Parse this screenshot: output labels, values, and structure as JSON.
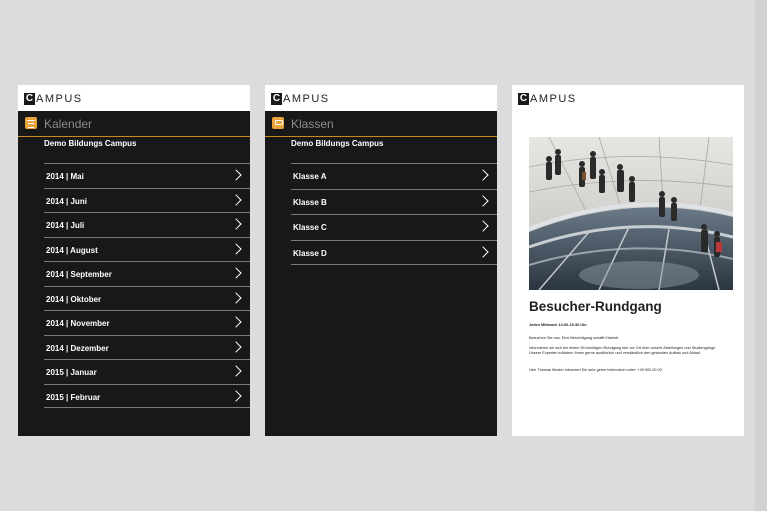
{
  "logo": {
    "initial": "C",
    "rest": "AMPUS"
  },
  "calendar": {
    "header": "Kalender",
    "icon": "calendar-icon",
    "subtitle": "Demo Bildungs Campus",
    "items": [
      {
        "label": "2014 | Mai"
      },
      {
        "label": "2014 | Juni"
      },
      {
        "label": "2014 | Juli"
      },
      {
        "label": "2014 | August"
      },
      {
        "label": "2014 | September"
      },
      {
        "label": "2014 | Oktober"
      },
      {
        "label": "2014 | November"
      },
      {
        "label": "2014 | Dezember"
      },
      {
        "label": "2015 | Januar"
      },
      {
        "label": "2015 | Februar"
      }
    ]
  },
  "classes": {
    "header": "Klassen",
    "icon": "classes-icon",
    "subtitle": "Demo Bildungs Campus",
    "items": [
      {
        "label": "Klasse A"
      },
      {
        "label": "Klasse B"
      },
      {
        "label": "Klasse C"
      },
      {
        "label": "Klasse D"
      }
    ]
  },
  "tour": {
    "title": "Besucher-Rundgang",
    "line1": "Jeden Mittwoch 14:00-15:30 Uhr",
    "line2": "Besuchen Sie uns. Eine Besichtigung schafft Klarheit.",
    "line3": "Informieren sie sich bei einem 90-minütigen Rundgang hier vor Ort über unsere Abteilungen und Studiengänge. Unsere Experten erläutern Ihnen gerne ausführlich und verständlich den gesamten Aufbau und Ablauf.",
    "line4": "Herr Thomas Muster informiert Sie sehr gerne telefonisch unter: +49 000 00 00."
  },
  "colors": {
    "panel_dark": "#181818",
    "accent": "#e8a33a",
    "divider": "#7a7a7a",
    "background": "#dcdcdc"
  }
}
